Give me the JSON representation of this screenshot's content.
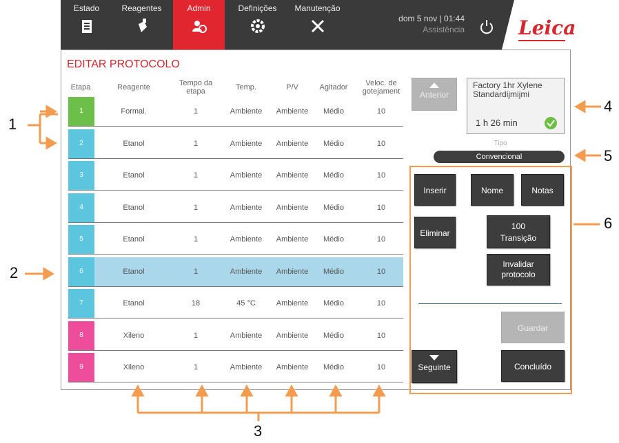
{
  "nav": {
    "tabs": [
      {
        "label": "Estado",
        "icon": "instrument-icon",
        "active": false
      },
      {
        "label": "Reagentes",
        "icon": "reagent-bottle-icon",
        "active": false
      },
      {
        "label": "Admin",
        "icon": "admin-users-icon",
        "active": true
      },
      {
        "label": "Definições",
        "icon": "gear-icon",
        "active": false
      },
      {
        "label": "Manutenção",
        "icon": "tools-icon",
        "active": false
      }
    ],
    "datetime": "dom 5 nov | 01:44",
    "status": "Assistência",
    "logo": "Leica",
    "accent_color": "#e2262f"
  },
  "panel": {
    "title": "EDITAR PROTOCOLO",
    "columns": [
      "Etapa",
      "Reagente",
      "Tempo da etapa",
      "Temp.",
      "P/V",
      "Agitador",
      "Veloc. de gotejament"
    ],
    "rows": [
      {
        "step": "1",
        "reagent": "Formal.",
        "time": "1",
        "temp": "Ambiente",
        "pv": "Ambiente",
        "agitator": "Médio",
        "drip": "10",
        "color": "#6cc04a"
      },
      {
        "step": "2",
        "reagent": "Etanol",
        "time": "1",
        "temp": "Ambiente",
        "pv": "Ambiente",
        "agitator": "Médio",
        "drip": "10",
        "color": "#5bc6de"
      },
      {
        "step": "3",
        "reagent": "Etanol",
        "time": "1",
        "temp": "Ambiente",
        "pv": "Ambiente",
        "agitator": "Médio",
        "drip": "10",
        "color": "#5bc6de"
      },
      {
        "step": "4",
        "reagent": "Etanol",
        "time": "1",
        "temp": "Ambiente",
        "pv": "Ambiente",
        "agitator": "Médio",
        "drip": "10",
        "color": "#5bc6de"
      },
      {
        "step": "5",
        "reagent": "Etanol",
        "time": "1",
        "temp": "Ambiente",
        "pv": "Ambiente",
        "agitator": "Médio",
        "drip": "10",
        "color": "#5bc6de"
      },
      {
        "step": "6",
        "reagent": "Etanol",
        "time": "1",
        "temp": "Ambiente",
        "pv": "Ambiente",
        "agitator": "Médio",
        "drip": "10",
        "color": "#5bc6de",
        "selected": true
      },
      {
        "step": "7",
        "reagent": "Etanol",
        "time": "18",
        "temp": "45 °C",
        "pv": "Ambiente",
        "agitator": "Médio",
        "drip": "10",
        "color": "#5bc6de"
      },
      {
        "step": "8",
        "reagent": "Xileno",
        "time": "1",
        "temp": "Ambiente",
        "pv": "Ambiente",
        "agitator": "Médio",
        "drip": "10",
        "color": "#ee4d9b"
      },
      {
        "step": "9",
        "reagent": "Xileno",
        "time": "1",
        "temp": "Ambiente",
        "pv": "Ambiente",
        "agitator": "Médio",
        "drip": "10",
        "color": "#ee4d9b"
      }
    ]
  },
  "side": {
    "previous": "Anterior",
    "next": "Seguinte",
    "protocol_name": "Factory 1hr Xylene Standardijmijmi",
    "duration": "1 h 26 min",
    "type_label": "Tipo",
    "type_value": "Convencional",
    "buttons": {
      "insert": "Inserir",
      "name": "Nome",
      "notes": "Notas",
      "delete": "Eliminar",
      "transition_value": "100",
      "transition_label": "Transição",
      "invalidate_line1": "Invalidar",
      "invalidate_line2": "protocolo",
      "save": "Guardar",
      "done": "Concluído"
    }
  },
  "callouts": [
    "1",
    "2",
    "3",
    "4",
    "5",
    "6"
  ],
  "annotation_color": "#f39b4f"
}
